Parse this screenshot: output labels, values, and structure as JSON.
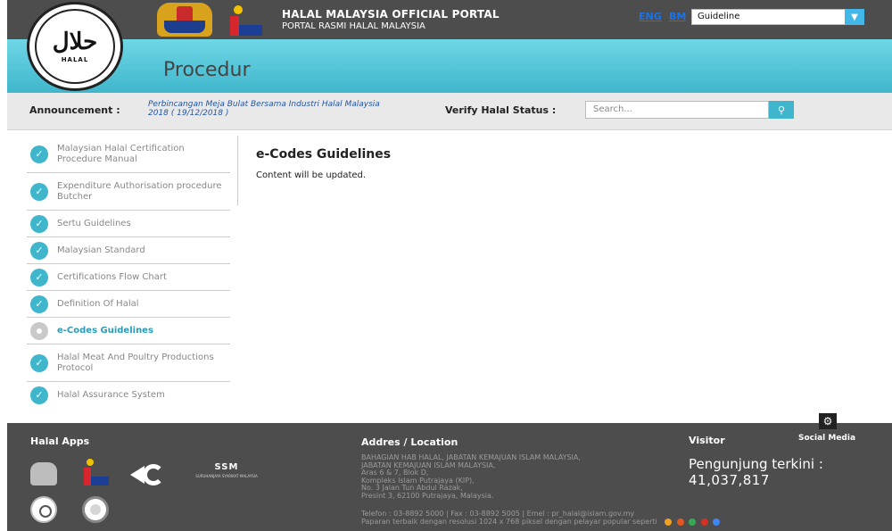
{
  "header": {
    "title": "HALAL MALAYSIA OFFICIAL PORTAL",
    "subtitle": "PORTAL RASMI HALAL MALAYSIA",
    "lang_eng": "ENG",
    "lang_bm": "BM",
    "guideline_select": "Guideline",
    "page_title": "Procedur"
  },
  "announcement": {
    "label": "Announcement :",
    "text": "Perbincangan Meja Bulat Bersama Industri Halal Malaysia 2018 ( 19/12/2018 )",
    "verify_label": "Verify Halal Status :",
    "search_placeholder": "Search..."
  },
  "sidebar": {
    "items": [
      {
        "label": "Malaysian Halal Certification Procedure Manual"
      },
      {
        "label": "Expenditure Authorisation procedure Butcher"
      },
      {
        "label": "Sertu Guidelines"
      },
      {
        "label": "Malaysian Standard"
      },
      {
        "label": "Certifications Flow Chart"
      },
      {
        "label": "Definition Of Halal"
      },
      {
        "label": "e-Codes Guidelines",
        "active": true
      },
      {
        "label": "Halal Meat And Poultry Productions Protocol"
      },
      {
        "label": "Halal Assurance System"
      }
    ]
  },
  "content": {
    "title": "e-Codes Guidelines",
    "body": "Content will be updated."
  },
  "footer": {
    "apps_heading": "Halal Apps",
    "address_heading": "Addres / Location",
    "address_lines": [
      "BAHAGIAN HAB HALAL, JABATAN KEMAJUAN ISLAM MALAYSIA,",
      "JABATAN KEMAJUAN ISLAM MALAYSIA,",
      "Aras 6 & 7, Blok D,",
      "Kompleks Islam Putrajaya (KIP),",
      "No. 3 Jalan Tun Abdul Razak,",
      "Presint 3, 62100 Putrajaya, Malaysia."
    ],
    "contact": "Telefon : 03-8892 5000 | Fax : 03-8892 5005 | Emel : pr_halal@islam.gov.my",
    "resolution": "Paparan terbaik dengan resolusi 1024 x 768 piksel dengan pelayar popular seperti",
    "visitor_heading": "Visitor",
    "visitor_label": "Pengunjung terkini :",
    "visitor_count": "41,037,817",
    "social_label": "Social Media",
    "ssm_text": "SSM",
    "ssm_sub": "SURUHANJAYA SYARIKAT MALAYSIA"
  },
  "colors": {
    "accent": "#3fb6cc",
    "dark_bar": "#4d4d4d",
    "link": "#2454a5"
  }
}
